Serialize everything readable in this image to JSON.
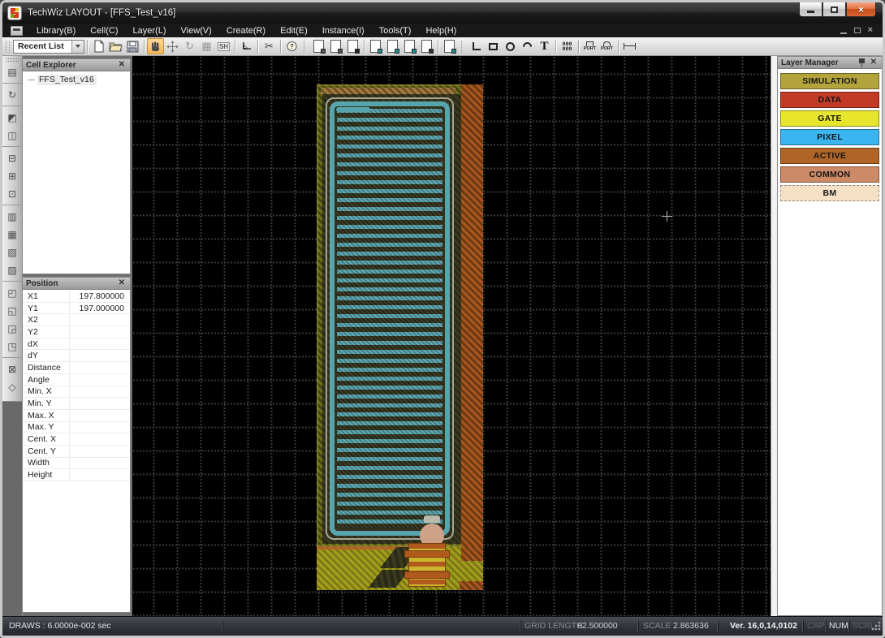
{
  "window": {
    "title": "TechWiz LAYOUT - [FFS_Test_v16]"
  },
  "menu": {
    "items": [
      {
        "name": "menu-item-library",
        "label": "Library(B)"
      },
      {
        "name": "menu-item-cell",
        "label": "Cell(C)"
      },
      {
        "name": "menu-item-layer",
        "label": "Layer(L)"
      },
      {
        "name": "menu-item-view",
        "label": "View(V)"
      },
      {
        "name": "menu-item-create",
        "label": "Create(R)"
      },
      {
        "name": "menu-item-edit",
        "label": "Edit(E)"
      },
      {
        "name": "menu-item-instance",
        "label": "Instance(I)"
      },
      {
        "name": "menu-item-tools",
        "label": "Tools(T)"
      },
      {
        "name": "menu-item-help",
        "label": "Help(H)"
      }
    ]
  },
  "toolbar": {
    "recent_list_value": "Recent List",
    "stretch_label": "SH",
    "text_tool_label": "T",
    "array_line1": "000",
    "array_line2": "000",
    "port_label": "PORT",
    "query_label": "?",
    "rotate_glyph": "↻",
    "doc_icons_a": [
      {
        "name": "toolbar-doc-grid-icon",
        "mark": "#555555"
      },
      {
        "name": "toolbar-doc-search-icon",
        "mark": "#555555"
      },
      {
        "name": "toolbar-doc-check-icon",
        "mark": "#222222"
      }
    ],
    "doc_icons_b": [
      {
        "name": "toolbar-doc-port-a-icon",
        "mark": "#1f8f8f"
      },
      {
        "name": "toolbar-doc-port-b-icon",
        "mark": "#1f8f8f"
      },
      {
        "name": "toolbar-doc-net-icon",
        "mark": "#1f8f8f"
      },
      {
        "name": "toolbar-doc-fill-icon",
        "mark": "#333333"
      }
    ],
    "doc_icon_c": {
      "mark": "#1f8f8f"
    }
  },
  "left_toolbar": {
    "icons": [
      {
        "name": "tool-cell-instance-icon",
        "glyph": "▤"
      },
      {
        "name": "tool-rotate-icon",
        "glyph": "↻",
        "sep": true
      },
      {
        "name": "tool-mirror-icon",
        "glyph": "◩",
        "sep": true
      },
      {
        "name": "tool-copy-icon",
        "glyph": "◫"
      },
      {
        "name": "tool-align-left-icon",
        "glyph": "⊟",
        "sep": true
      },
      {
        "name": "tool-align-center-icon",
        "glyph": "⊞"
      },
      {
        "name": "tool-align-right-icon",
        "glyph": "⊡"
      },
      {
        "name": "tool-distribute-h-icon",
        "glyph": "▥",
        "sep": true
      },
      {
        "name": "tool-distribute-v-icon",
        "glyph": "▦"
      },
      {
        "name": "tool-spacing-h-icon",
        "glyph": "▧"
      },
      {
        "name": "tool-spacing-v-icon",
        "glyph": "▨"
      },
      {
        "name": "tool-merge-icon",
        "glyph": "◰",
        "sep": true
      },
      {
        "name": "tool-subtract-icon",
        "glyph": "◱"
      },
      {
        "name": "tool-intersect-icon",
        "glyph": "◲"
      },
      {
        "name": "tool-xor-icon",
        "glyph": "◳"
      },
      {
        "name": "tool-group-icon",
        "glyph": "⊠",
        "sep": true
      },
      {
        "name": "tool-measure-icon",
        "glyph": "◇"
      }
    ]
  },
  "cell_explorer": {
    "title": "Cell Explorer",
    "close_glyph": "✕",
    "items": [
      {
        "label": "FFS_Test_v16"
      }
    ]
  },
  "position_panel": {
    "title": "Position",
    "close_glyph": "✕",
    "rows": [
      {
        "label": "X1",
        "value": "197.800000"
      },
      {
        "label": "Y1",
        "value": "197.000000"
      },
      {
        "label": "X2",
        "value": ""
      },
      {
        "label": "Y2",
        "value": ""
      },
      {
        "label": "dX",
        "value": ""
      },
      {
        "label": "dY",
        "value": ""
      },
      {
        "label": "Distance",
        "value": ""
      },
      {
        "label": "Angle",
        "value": ""
      },
      {
        "label": "Min. X",
        "value": ""
      },
      {
        "label": "Min. Y",
        "value": ""
      },
      {
        "label": "Max. X",
        "value": ""
      },
      {
        "label": "Max. Y",
        "value": ""
      },
      {
        "label": "Cent. X",
        "value": ""
      },
      {
        "label": "Cent. Y",
        "value": ""
      },
      {
        "label": "Width",
        "value": ""
      },
      {
        "label": "Height",
        "value": ""
      }
    ]
  },
  "layer_manager": {
    "title": "Layer Manager",
    "close_glyph": "✕",
    "layers": [
      {
        "id": "layer-button-simulation",
        "name": "SIMULATION",
        "color": "#b2a33c",
        "border": "#7d7128"
      },
      {
        "id": "layer-button-data",
        "name": "DATA",
        "color": "#c33b27",
        "border": "#86261a"
      },
      {
        "id": "layer-button-gate",
        "name": "GATE",
        "color": "#e8e62c",
        "border": "#9e9c1e"
      },
      {
        "id": "layer-button-pixel",
        "name": "PIXEL",
        "color": "#3bb5f0",
        "border": "#2679a2"
      },
      {
        "id": "layer-button-active",
        "name": "ACTIVE",
        "color": "#b06425",
        "border": "#774418"
      },
      {
        "id": "layer-button-common",
        "name": "COMMON",
        "color": "#cd8a66",
        "border": "#8c5e45"
      },
      {
        "id": "layer-button-bm",
        "name": "BM",
        "color": "#f7e1c6",
        "border": "#c08a55",
        "selected": true
      }
    ]
  },
  "canvas": {
    "palette": {
      "background": "#000000",
      "pixel_trace": "#58a4ae",
      "simulation_hatch": "#6f6f1e",
      "gate_hatch": "#a49e1c",
      "active_hatch": "#a85620",
      "common_pad": "#cfa189"
    }
  },
  "status_bar": {
    "draws": "DRAWS : 6.0000e-002 sec",
    "grid_length_label": "GRID LENGTH",
    "grid_length_value": "62.500000",
    "scale_label": "SCALE",
    "scale_value": "2.863636",
    "version": "Ver. 16,0,14,0102",
    "caps_label": "CAP",
    "num_label": "NUM",
    "scroll_label": "SCRL"
  }
}
